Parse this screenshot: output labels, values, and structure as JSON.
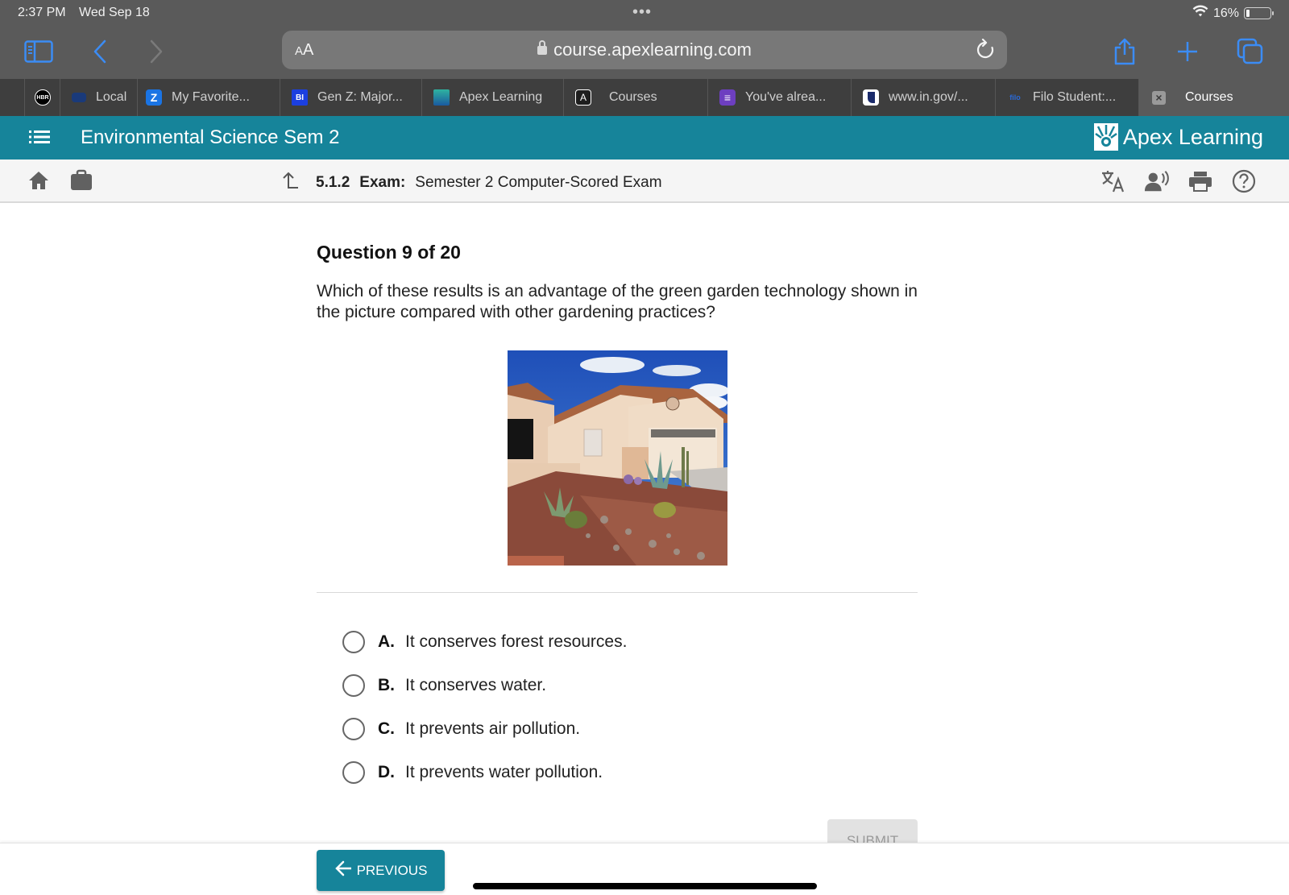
{
  "status_bar": {
    "time": "2:37 PM",
    "date": "Wed Sep 18",
    "battery_percent_label": "16%",
    "battery_level": 0.16,
    "multitask_dots": "•••"
  },
  "browser": {
    "text_size_label_small": "A",
    "text_size_label_large": "A",
    "url": "course.apexlearning.com",
    "tabs": [
      {
        "label": "",
        "favicon": "HBR",
        "favicon_bg": "#000000",
        "favicon_fg": "#ffffff"
      },
      {
        "label": "Local",
        "favicon": "",
        "favicon_bg": "#1a3a7a",
        "favicon_fg": "#ffffff"
      },
      {
        "label": "My Favorite...",
        "favicon": "Z",
        "favicon_bg": "#1a74e4",
        "favicon_fg": "#ffffff"
      },
      {
        "label": "Gen Z: Major...",
        "favicon": "BI",
        "favicon_bg": "#1b3fe0",
        "favicon_fg": "#ffffff"
      },
      {
        "label": "Apex Learning",
        "favicon": "",
        "favicon_bg": "#16849a",
        "favicon_fg": "#ffffff"
      },
      {
        "label": "Courses",
        "favicon": "A",
        "favicon_bg": "#1e1e1e",
        "favicon_fg": "#ffffff"
      },
      {
        "label": "You've alrea...",
        "favicon": "≡",
        "favicon_bg": "#6d3fc0",
        "favicon_fg": "#ffffff"
      },
      {
        "label": "www.in.gov/...",
        "favicon": "",
        "favicon_bg": "#ffffff",
        "favicon_fg": "#1a2a6a"
      },
      {
        "label": "Filo Student:...",
        "favicon": "filo",
        "favicon_bg": "transparent",
        "favicon_fg": "#2a6ad8"
      },
      {
        "label": "Courses",
        "favicon": "×",
        "favicon_bg": "#9a9a9a",
        "favicon_fg": "#3e3e3e",
        "active": true
      }
    ]
  },
  "header": {
    "course_title": "Environmental Science Sem 2",
    "brand": "Apex Learning",
    "brand_color": "#16849a"
  },
  "subbar": {
    "activity_number": "5.1.2",
    "activity_type": "Exam:",
    "activity_title": "Semester 2 Computer-Scored Exam"
  },
  "question": {
    "number_label": "Question 9 of 20",
    "text": "Which of these results is an advantage of the green garden technology shown in the picture compared with other gardening practices?",
    "image_alt": "House with xeriscaped desert garden of cacti, agave and gravel",
    "options": [
      {
        "letter": "A.",
        "text": "It conserves forest resources."
      },
      {
        "letter": "B.",
        "text": "It conserves water."
      },
      {
        "letter": "C.",
        "text": "It prevents air pollution."
      },
      {
        "letter": "D.",
        "text": "It prevents water pollution."
      }
    ]
  },
  "actions": {
    "submit_label": "SUBMIT",
    "previous_label": "PREVIOUS"
  }
}
